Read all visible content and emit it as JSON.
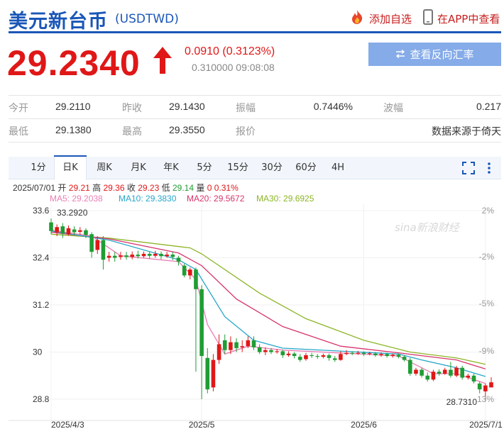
{
  "header": {
    "title": "美元新台币",
    "code": "(USDTWD)",
    "add_watchlist": "添加自选",
    "app_view": "在APP中查看"
  },
  "quote": {
    "price": "29.2340",
    "change": "0.0910 (0.3123%)",
    "sub": "0.310000 09:08:08",
    "reverse_button": "查看反向汇率"
  },
  "stats": {
    "row1": [
      {
        "label": "今开",
        "value": "29.2110"
      },
      {
        "label": "昨收",
        "value": "29.1430"
      },
      {
        "label": "振幅",
        "value": "0.7446%"
      },
      {
        "label": "波幅",
        "value": "0.217"
      }
    ],
    "row2": [
      {
        "label": "最低",
        "value": "29.1380"
      },
      {
        "label": "最高",
        "value": "29.3550"
      },
      {
        "label": "报价",
        "value": "数据来源于倚天"
      }
    ]
  },
  "tabs": [
    "1分",
    "日K",
    "周K",
    "月K",
    "年K",
    "5分",
    "15分",
    "30分",
    "60分",
    "4H"
  ],
  "active_tab": "日K",
  "ohlc": {
    "date": "2025/07/01",
    "open_label": "开",
    "open": "29.21",
    "high_label": "高",
    "high": "29.36",
    "close_label": "收",
    "close": "29.23",
    "low_label": "低",
    "low": "29.14",
    "vol_label": "量",
    "vol": "0",
    "pct": "0.31%"
  },
  "ma": [
    {
      "label": "MA5: 29.2038",
      "color": "#e97fb4"
    },
    {
      "label": "MA10: 29.3830",
      "color": "#26a6c9"
    },
    {
      "label": "MA20: 29.5672",
      "color": "#d6336c"
    },
    {
      "label": "MA30: 29.6925",
      "color": "#8cb526"
    }
  ],
  "chart_data": {
    "type": "candlestick",
    "y_ticks": [
      "33.6",
      "32.4",
      "31.2",
      "30",
      "28.8"
    ],
    "pct_ticks": [
      "2%",
      "-2%",
      "-5%",
      "-9%",
      "13%"
    ],
    "x_ticks": [
      "2025/4/3",
      "2025/5",
      "2025/6",
      "2025/7/1"
    ],
    "ylim": [
      28.2,
      33.8
    ],
    "annotations": {
      "high": "33.2920",
      "low": "28.7310"
    },
    "watermark": "sina新浪财经",
    "candles": [
      [
        33.3,
        33.08,
        33.4,
        33.0
      ],
      [
        33.05,
        33.18,
        33.25,
        32.95
      ],
      [
        33.2,
        33.02,
        33.28,
        32.9
      ],
      [
        33.0,
        33.15,
        33.22,
        32.96
      ],
      [
        33.12,
        33.05,
        33.2,
        32.98
      ],
      [
        33.06,
        33.1,
        33.18,
        32.99
      ],
      [
        33.1,
        32.98,
        33.15,
        32.9
      ],
      [
        33.0,
        32.55,
        33.05,
        32.4
      ],
      [
        32.6,
        32.85,
        32.95,
        32.5
      ],
      [
        32.85,
        32.35,
        32.95,
        32.1
      ],
      [
        32.4,
        32.45,
        32.55,
        32.3
      ],
      [
        32.45,
        32.4,
        32.55,
        32.3
      ],
      [
        32.42,
        32.46,
        32.55,
        32.35
      ],
      [
        32.46,
        32.42,
        32.55,
        32.35
      ],
      [
        32.42,
        32.48,
        32.56,
        32.36
      ],
      [
        32.48,
        32.44,
        32.58,
        32.38
      ],
      [
        32.44,
        32.5,
        32.56,
        32.4
      ],
      [
        32.5,
        32.45,
        32.56,
        32.38
      ],
      [
        32.45,
        32.5,
        32.58,
        32.4
      ],
      [
        32.5,
        32.44,
        32.56,
        32.36
      ],
      [
        32.44,
        32.48,
        32.55,
        32.4
      ],
      [
        32.48,
        32.42,
        32.55,
        32.34
      ],
      [
        32.4,
        32.3,
        32.45,
        32.2
      ],
      [
        32.2,
        31.95,
        32.25,
        31.9
      ],
      [
        31.95,
        32.1,
        32.15,
        31.85
      ],
      [
        32.1,
        31.6,
        32.15,
        29.5
      ],
      [
        31.6,
        29.9,
        31.7,
        28.8
      ],
      [
        29.85,
        29.05,
        30.1,
        28.95
      ],
      [
        29.1,
        29.8,
        29.95,
        29.0
      ],
      [
        29.8,
        30.2,
        30.45,
        29.7
      ],
      [
        30.3,
        30.05,
        30.45,
        29.95
      ],
      [
        30.05,
        30.25,
        30.4,
        29.95
      ],
      [
        30.25,
        30.1,
        30.35,
        30.0
      ],
      [
        30.12,
        30.15,
        30.3,
        30.0
      ],
      [
        30.15,
        30.3,
        30.4,
        30.1
      ],
      [
        30.3,
        30.12,
        30.4,
        30.05
      ],
      [
        30.12,
        30.0,
        30.2,
        29.95
      ],
      [
        30.0,
        30.05,
        30.12,
        29.92
      ],
      [
        30.05,
        30.0,
        30.1,
        29.95
      ],
      [
        30.0,
        30.02,
        30.08,
        29.96
      ],
      [
        30.02,
        29.92,
        30.06,
        29.85
      ],
      [
        29.92,
        29.96,
        30.02,
        29.88
      ],
      [
        29.96,
        29.9,
        30.0,
        29.84
      ],
      [
        29.88,
        29.8,
        29.95,
        29.75
      ],
      [
        29.82,
        29.92,
        29.98,
        29.78
      ],
      [
        29.92,
        29.9,
        29.98,
        29.85
      ],
      [
        29.9,
        29.88,
        29.95,
        29.83
      ],
      [
        29.88,
        29.92,
        29.96,
        29.84
      ],
      [
        29.92,
        29.85,
        29.96,
        29.78
      ],
      [
        29.84,
        29.8,
        29.9,
        29.75
      ],
      [
        29.8,
        29.95,
        30.02,
        29.78
      ],
      [
        29.95,
        29.98,
        30.05,
        29.92
      ],
      [
        29.98,
        29.96,
        30.02,
        29.92
      ],
      [
        29.96,
        29.98,
        30.03,
        29.93
      ],
      [
        29.98,
        29.95,
        30.02,
        29.9
      ],
      [
        29.95,
        29.97,
        30.01,
        29.92
      ],
      [
        29.96,
        29.92,
        30.0,
        29.88
      ],
      [
        29.92,
        29.95,
        29.99,
        29.88
      ],
      [
        29.95,
        29.9,
        29.98,
        29.86
      ],
      [
        29.9,
        29.93,
        29.96,
        29.86
      ],
      [
        29.93,
        29.88,
        29.96,
        29.84
      ],
      [
        29.88,
        29.8,
        29.92,
        29.76
      ],
      [
        29.8,
        29.45,
        29.85,
        29.4
      ],
      [
        29.45,
        29.55,
        29.6,
        29.4
      ],
      [
        29.55,
        29.4,
        29.6,
        29.35
      ],
      [
        29.4,
        29.3,
        29.48,
        29.25
      ],
      [
        29.3,
        29.5,
        29.55,
        29.26
      ],
      [
        29.5,
        29.45,
        29.56,
        29.4
      ],
      [
        29.45,
        29.55,
        29.6,
        29.42
      ],
      [
        29.55,
        29.4,
        29.75,
        29.35
      ],
      [
        29.4,
        29.6,
        29.65,
        29.36
      ],
      [
        29.6,
        29.35,
        29.65,
        29.3
      ],
      [
        29.35,
        29.4,
        29.45,
        29.3
      ],
      [
        29.4,
        29.25,
        29.45,
        29.2
      ],
      [
        29.2,
        29.05,
        29.25,
        28.95
      ],
      [
        29.0,
        29.15,
        29.2,
        28.75
      ],
      [
        29.1,
        29.23,
        29.36,
        29.14
      ]
    ],
    "ma5": [
      [
        0,
        33.1
      ],
      [
        7,
        32.95
      ],
      [
        12,
        32.45
      ],
      [
        22,
        32.3
      ],
      [
        25,
        31.85
      ],
      [
        27,
        30.7
      ],
      [
        30,
        29.95
      ],
      [
        34,
        30.15
      ],
      [
        40,
        30.05
      ],
      [
        60,
        29.9
      ],
      [
        62,
        29.75
      ],
      [
        66,
        29.45
      ],
      [
        70,
        29.45
      ],
      [
        73,
        29.3
      ],
      [
        75,
        29.2
      ]
    ],
    "ma10": [
      [
        0,
        33.08
      ],
      [
        10,
        32.85
      ],
      [
        22,
        32.35
      ],
      [
        25,
        32.1
      ],
      [
        30,
        30.9
      ],
      [
        35,
        30.3
      ],
      [
        40,
        30.1
      ],
      [
        60,
        29.95
      ],
      [
        64,
        29.8
      ],
      [
        70,
        29.6
      ],
      [
        75,
        29.38
      ]
    ],
    "ma20": [
      [
        0,
        33.05
      ],
      [
        10,
        32.88
      ],
      [
        22,
        32.52
      ],
      [
        26,
        32.2
      ],
      [
        32,
        31.35
      ],
      [
        40,
        30.65
      ],
      [
        50,
        30.15
      ],
      [
        60,
        29.98
      ],
      [
        70,
        29.8
      ],
      [
        75,
        29.57
      ]
    ],
    "ma30": [
      [
        0,
        33.0
      ],
      [
        10,
        32.9
      ],
      [
        24,
        32.65
      ],
      [
        26,
        32.5
      ],
      [
        36,
        31.5
      ],
      [
        44,
        30.85
      ],
      [
        54,
        30.3
      ],
      [
        62,
        30.0
      ],
      [
        70,
        29.85
      ],
      [
        75,
        29.69
      ]
    ]
  }
}
